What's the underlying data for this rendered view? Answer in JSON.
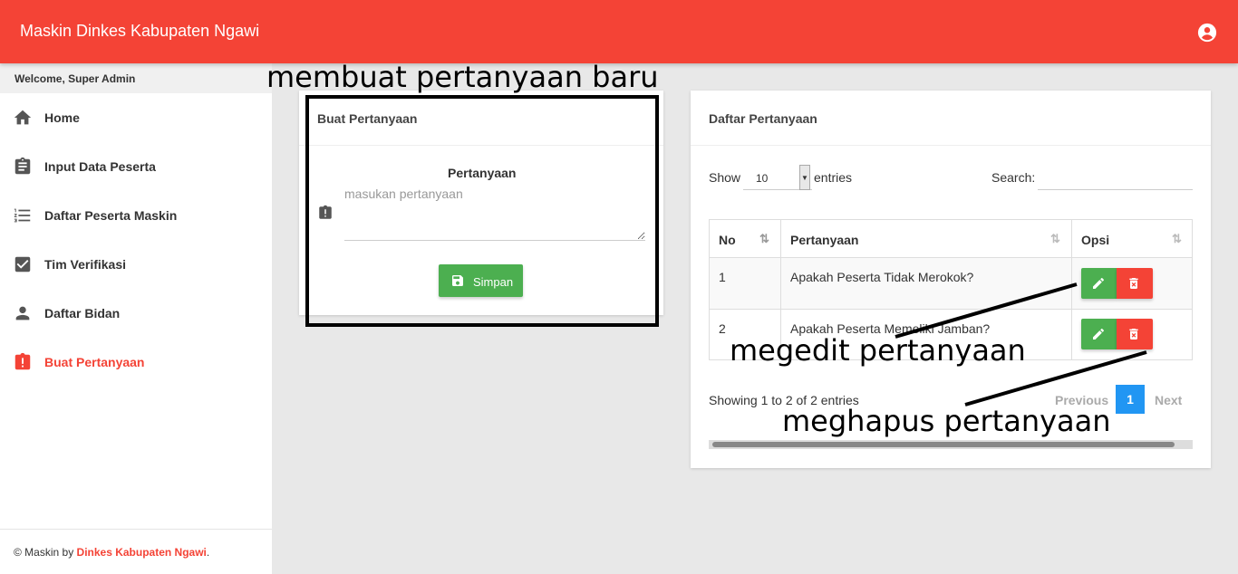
{
  "app": {
    "title": "Maskin Dinkes Kabupaten Ngawi"
  },
  "sidebar": {
    "welcome": "Welcome, Super Admin",
    "items": [
      {
        "label": "Home",
        "icon": "home-icon"
      },
      {
        "label": "Input Data Peserta",
        "icon": "assignment-icon"
      },
      {
        "label": "Daftar Peserta Maskin",
        "icon": "list-icon"
      },
      {
        "label": "Tim Verifikasi",
        "icon": "verified-icon"
      },
      {
        "label": "Daftar Bidan",
        "icon": "person-icon"
      },
      {
        "label": "Buat Pertanyaan",
        "icon": "report-icon",
        "active": true
      }
    ],
    "footer": {
      "prefix": "© Maskin by ",
      "link": "Dinkes Kabupaten Ngawi",
      "suffix": "."
    }
  },
  "form": {
    "title": "Buat Pertanyaan",
    "label": "Pertanyaan",
    "placeholder": "masukan pertanyaan",
    "save_label": "Simpan"
  },
  "list": {
    "title": "Daftar Pertanyaan",
    "show_label": "Show",
    "page_length": "10",
    "entries_label": "entries",
    "search_label": "Search:",
    "columns": [
      "No",
      "Pertanyaan",
      "Opsi"
    ],
    "rows": [
      {
        "no": "1",
        "question": "Apakah Peserta Tidak Merokok?"
      },
      {
        "no": "2",
        "question": "Apakah Peserta Memeliki Jamban?"
      }
    ],
    "info": "Showing 1 to 2 of 2 entries",
    "previous": "Previous",
    "current_page": "1",
    "next": "Next"
  },
  "annotations": {
    "create": "membuat pertanyaan baru",
    "edit": "megedit pertanyaan",
    "delete": "meghapus pertanyaan"
  },
  "colors": {
    "primary": "#f44336",
    "success": "#4caf50",
    "info": "#2196f3"
  }
}
